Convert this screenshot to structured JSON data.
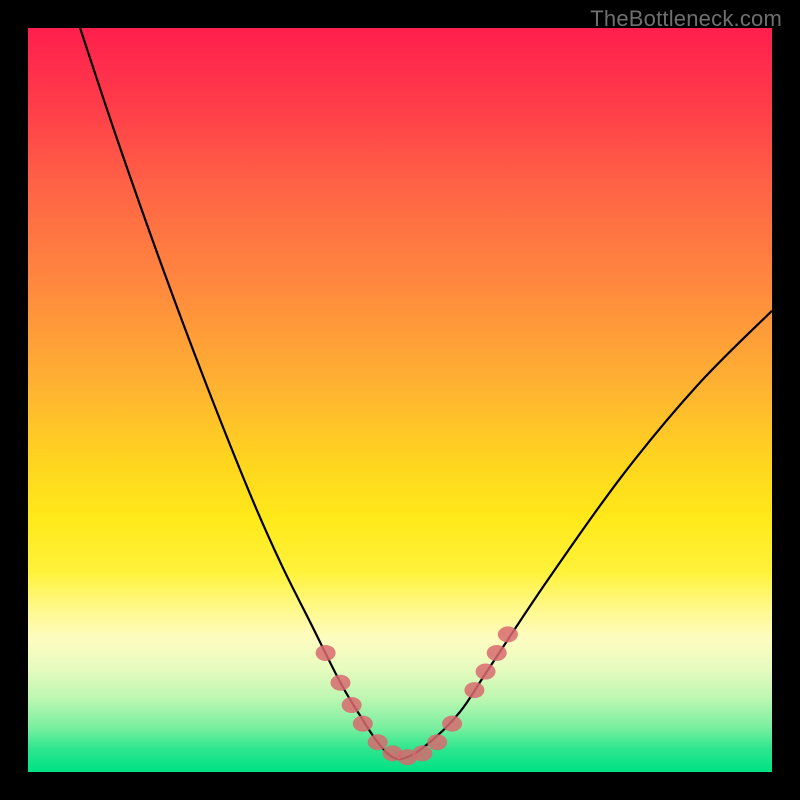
{
  "watermark": "TheBottleneck.com",
  "chart_data": {
    "type": "line",
    "title": "",
    "xlabel": "",
    "ylabel": "",
    "xlim": [
      0,
      100
    ],
    "ylim": [
      0,
      100
    ],
    "grid": false,
    "legend": false,
    "series": [
      {
        "name": "curve",
        "x": [
          7,
          12,
          18,
          24,
          30,
          34,
          38,
          42,
          45,
          47,
          49,
          51,
          54,
          58,
          62,
          70,
          80,
          90,
          100
        ],
        "y": [
          100,
          85,
          68,
          52,
          37,
          28,
          20,
          12,
          7,
          4,
          2,
          2,
          4,
          8,
          14,
          26,
          40,
          52,
          62
        ]
      }
    ],
    "highlight_points": {
      "name": "dots",
      "x": [
        40,
        42,
        43.5,
        45,
        47,
        49,
        51,
        53,
        55,
        57,
        60,
        61.5,
        63,
        64.5
      ],
      "y": [
        16,
        12,
        9,
        6.5,
        4,
        2.5,
        2,
        2.5,
        4,
        6.5,
        11,
        13.5,
        16,
        18.5
      ]
    },
    "background": {
      "type": "vertical-gradient",
      "stops": [
        {
          "pos": 0.0,
          "color": "#ff1f4d"
        },
        {
          "pos": 0.5,
          "color": "#ffc628"
        },
        {
          "pos": 0.78,
          "color": "#fff98a"
        },
        {
          "pos": 1.0,
          "color": "#00e184"
        }
      ]
    }
  }
}
